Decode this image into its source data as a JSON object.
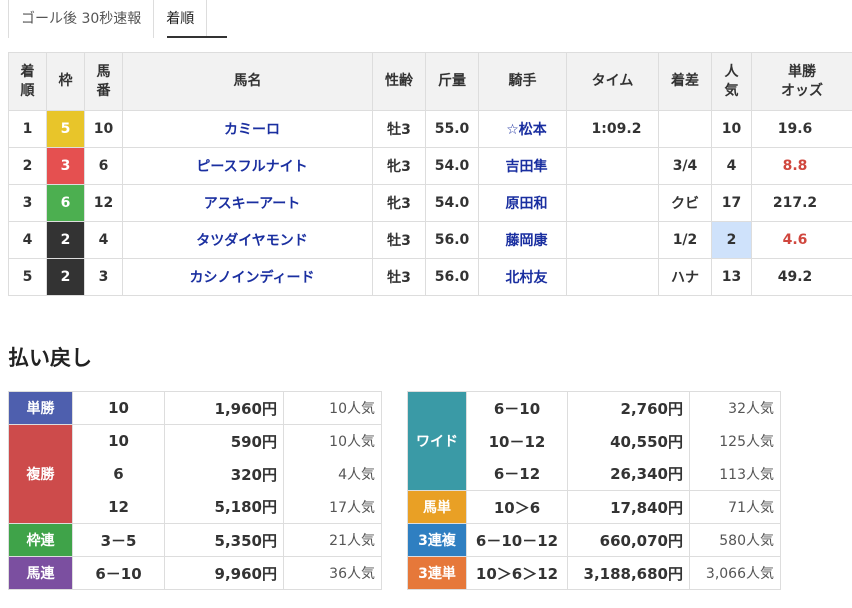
{
  "tabs": [
    {
      "label": "ゴール後 30秒速報",
      "active": false
    },
    {
      "label": "着順",
      "active": true
    }
  ],
  "results": {
    "headers": {
      "rank": "着\n順",
      "waku": "枠",
      "umaban": "馬\n番",
      "name": "馬名",
      "sexage": "性齢",
      "weight": "斤量",
      "jockey": "騎手",
      "time": "タイム",
      "margin": "着差",
      "pop": "人\n気",
      "odds": "単勝\nオッズ"
    },
    "rows": [
      {
        "rank": "1",
        "waku": "5",
        "waku_color": "#e8c52a",
        "waku_text": "#ffffff",
        "umaban": "10",
        "name": "カミーロ",
        "sexage": "牡3",
        "weight": "55.0",
        "jockey": "☆松本",
        "time": "1:09.2",
        "margin": "",
        "pop": "10",
        "odds": "19.6",
        "odds_red": false,
        "pop_highlight": false
      },
      {
        "rank": "2",
        "waku": "3",
        "waku_color": "#e55050",
        "waku_text": "#ffffff",
        "umaban": "6",
        "name": "ピースフルナイト",
        "sexage": "牝3",
        "weight": "54.0",
        "jockey": "吉田隼",
        "time": "",
        "margin": "3/4",
        "pop": "4",
        "odds": "8.8",
        "odds_red": true,
        "pop_highlight": false
      },
      {
        "rank": "3",
        "waku": "6",
        "waku_color": "#4caf50",
        "waku_text": "#ffffff",
        "umaban": "12",
        "name": "アスキーアート",
        "sexage": "牝3",
        "weight": "54.0",
        "jockey": "原田和",
        "time": "",
        "margin": "クビ",
        "pop": "17",
        "odds": "217.2",
        "odds_red": false,
        "pop_highlight": false
      },
      {
        "rank": "4",
        "waku": "2",
        "waku_color": "#333333",
        "waku_text": "#ffffff",
        "umaban": "4",
        "name": "タツダイヤモンド",
        "sexage": "牡3",
        "weight": "56.0",
        "jockey": "藤岡康",
        "time": "",
        "margin": "1/2",
        "pop": "2",
        "odds": "4.6",
        "odds_red": true,
        "pop_highlight": true
      },
      {
        "rank": "5",
        "waku": "2",
        "waku_color": "#333333",
        "waku_text": "#ffffff",
        "umaban": "3",
        "name": "カシノインディード",
        "sexage": "牡3",
        "weight": "56.0",
        "jockey": "北村友",
        "time": "",
        "margin": "ハナ",
        "pop": "13",
        "odds": "49.2",
        "odds_red": false,
        "pop_highlight": false
      }
    ]
  },
  "payout": {
    "title": "払い戻し",
    "left": [
      {
        "type": "単勝",
        "color": "#4e5fae",
        "entries": [
          {
            "combo": "10",
            "yen": "1,960円",
            "ninki": "10人気"
          }
        ]
      },
      {
        "type": "複勝",
        "color": "#cd4b4b",
        "entries": [
          {
            "combo": "10",
            "yen": "590円",
            "ninki": "10人気"
          },
          {
            "combo": "6",
            "yen": "320円",
            "ninki": "4人気"
          },
          {
            "combo": "12",
            "yen": "5,180円",
            "ninki": "17人気"
          }
        ]
      },
      {
        "type": "枠連",
        "color": "#3fa349",
        "entries": [
          {
            "combo": "3－5",
            "yen": "5,350円",
            "ninki": "21人気"
          }
        ]
      },
      {
        "type": "馬連",
        "color": "#7b4fa0",
        "entries": [
          {
            "combo": "6－10",
            "yen": "9,960円",
            "ninki": "36人気"
          }
        ]
      }
    ],
    "right": [
      {
        "type": "ワイド",
        "color": "#3a9aa6",
        "entries": [
          {
            "combo": "6－10",
            "yen": "2,760円",
            "ninki": "32人気"
          },
          {
            "combo": "10－12",
            "yen": "40,550円",
            "ninki": "125人気"
          },
          {
            "combo": "6－12",
            "yen": "26,340円",
            "ninki": "113人気"
          }
        ]
      },
      {
        "type": "馬単",
        "color": "#e9a025",
        "entries": [
          {
            "combo": "10＞6",
            "yen": "17,840円",
            "ninki": "71人気"
          }
        ]
      },
      {
        "type": "3連複",
        "color": "#2f7fc1",
        "entries": [
          {
            "combo": "6－10－12",
            "yen": "660,070円",
            "ninki": "580人気"
          }
        ]
      },
      {
        "type": "3連単",
        "color": "#e6783a",
        "entries": [
          {
            "combo": "10＞6＞12",
            "yen": "3,188,680円",
            "ninki": "3,066人気"
          }
        ]
      }
    ]
  }
}
